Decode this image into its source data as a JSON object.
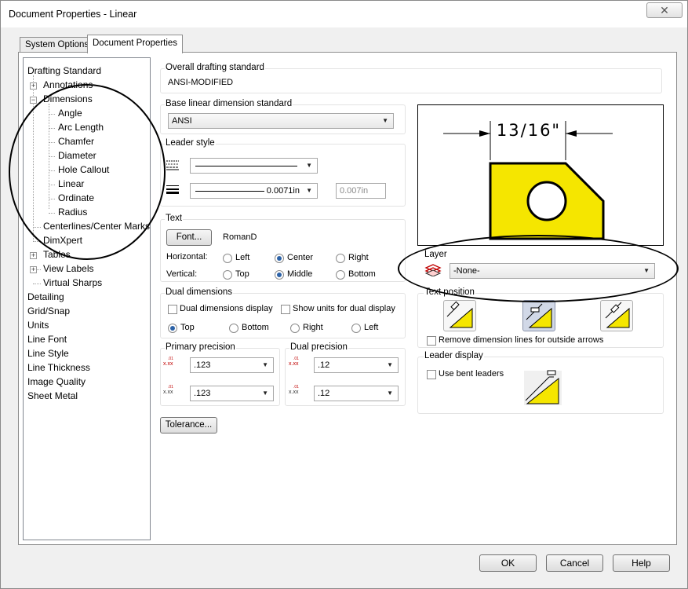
{
  "window": {
    "title": "Document Properties - Linear",
    "close_label": "✕"
  },
  "tabs": [
    {
      "label": "System Options"
    },
    {
      "label": "Document Properties"
    }
  ],
  "tree": {
    "items": [
      {
        "label": "Drafting Standard"
      },
      {
        "label": "Annotations"
      },
      {
        "label": "Dimensions"
      },
      {
        "label": "Angle"
      },
      {
        "label": "Arc Length"
      },
      {
        "label": "Chamfer"
      },
      {
        "label": "Diameter"
      },
      {
        "label": "Hole Callout"
      },
      {
        "label": "Linear"
      },
      {
        "label": "Ordinate"
      },
      {
        "label": "Radius"
      },
      {
        "label": "Centerlines/Center Marks"
      },
      {
        "label": "DimXpert"
      },
      {
        "label": "Tables"
      },
      {
        "label": "View Labels"
      },
      {
        "label": "Virtual Sharps"
      },
      {
        "label": "Detailing"
      },
      {
        "label": "Grid/Snap"
      },
      {
        "label": "Units"
      },
      {
        "label": "Line Font"
      },
      {
        "label": "Line Style"
      },
      {
        "label": "Line Thickness"
      },
      {
        "label": "Image Quality"
      },
      {
        "label": "Sheet Metal"
      }
    ]
  },
  "overall": {
    "label": "Overall drafting standard",
    "value": "ANSI-MODIFIED"
  },
  "base_linear": {
    "label": "Base linear dimension standard",
    "value": "ANSI"
  },
  "leader_style": {
    "label": "Leader style",
    "thickness_value": "0.0071in",
    "custom_value": "0.007in"
  },
  "text": {
    "label": "Text",
    "font_button": "Font...",
    "font_name": "RomanD",
    "horizontal_label": "Horizontal:",
    "vertical_label": "Vertical:",
    "h_options": [
      "Left",
      "Center",
      "Right"
    ],
    "v_options": [
      "Top",
      "Middle",
      "Bottom"
    ]
  },
  "dual": {
    "label": "Dual dimensions",
    "display_label": "Dual dimensions display",
    "units_label": "Show units for dual display",
    "positions": [
      "Top",
      "Bottom",
      "Right",
      "Left"
    ]
  },
  "primary_precision": {
    "label": "Primary precision",
    "value1": ".123",
    "value2": ".123"
  },
  "dual_precision": {
    "label": "Dual precision",
    "value1": ".12",
    "value2": ".12"
  },
  "tolerance_button": "Tolerance...",
  "preview": {
    "dim_text": "13/16\""
  },
  "layer": {
    "label": "Layer",
    "value": "-None-"
  },
  "text_position": {
    "label": "Text position",
    "remove_label": "Remove dimension lines for outside arrows"
  },
  "leader_display": {
    "label": "Leader display",
    "bent_label": "Use bent leaders"
  },
  "buttons": {
    "ok": "OK",
    "cancel": "Cancel",
    "help": "Help"
  },
  "colors": {
    "part_fill": "#f5e600",
    "accent_radio": "#2c62a7",
    "selected_position": "#d1d8e7"
  }
}
